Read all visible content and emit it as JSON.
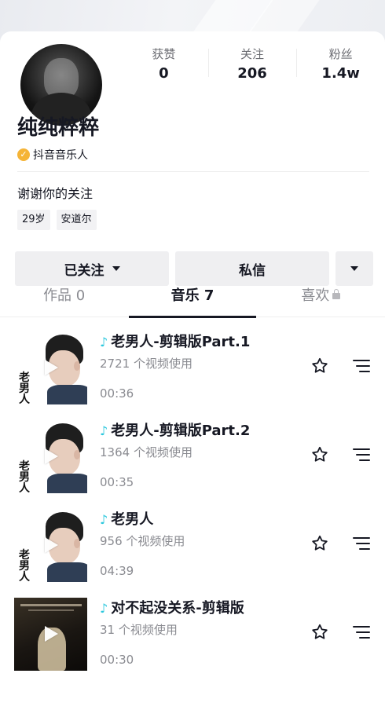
{
  "stats": [
    {
      "label": "获赞",
      "value": "0"
    },
    {
      "label": "关注",
      "value": "206"
    },
    {
      "label": "粉丝",
      "value": "1.4w"
    }
  ],
  "profile": {
    "nickname": "纯纯粹粹",
    "verification": "抖音音乐人",
    "signature": "谢谢你的关注",
    "tags": [
      "29岁",
      "安道尔"
    ]
  },
  "actions": {
    "follow_label": "已关注",
    "message_label": "私信"
  },
  "tabs": [
    {
      "label": "作品 0",
      "active": false
    },
    {
      "label": "音乐 7",
      "active": true
    },
    {
      "label": "喜欢",
      "active": false,
      "locked": true
    }
  ],
  "music": [
    {
      "title": "老男人-剪辑版Part.1",
      "usage": "2721 个视频使用",
      "duration": "00:36",
      "cover_text": "老男人"
    },
    {
      "title": "老男人-剪辑版Part.2",
      "usage": "1364 个视频使用",
      "duration": "00:35",
      "cover_text": "老男人"
    },
    {
      "title": "老男人",
      "usage": "956 个视频使用",
      "duration": "04:39",
      "cover_text": "老男人"
    },
    {
      "title": "对不起没关系-剪辑版",
      "usage": "31 个视频使用",
      "duration": "00:30"
    }
  ],
  "colors": {
    "accent_note": "#2ac7dd",
    "verify_badge": "#f5b437",
    "text_primary": "#161823",
    "text_secondary": "#8a8b91",
    "button_bg": "#efeff1"
  },
  "icons": {
    "verify": "verified-badge-icon",
    "note": "music-note-icon",
    "play": "play-icon",
    "favorite": "star-icon",
    "more": "menu-lines-icon",
    "dropdown": "caret-down-icon",
    "lock": "lock-icon"
  }
}
